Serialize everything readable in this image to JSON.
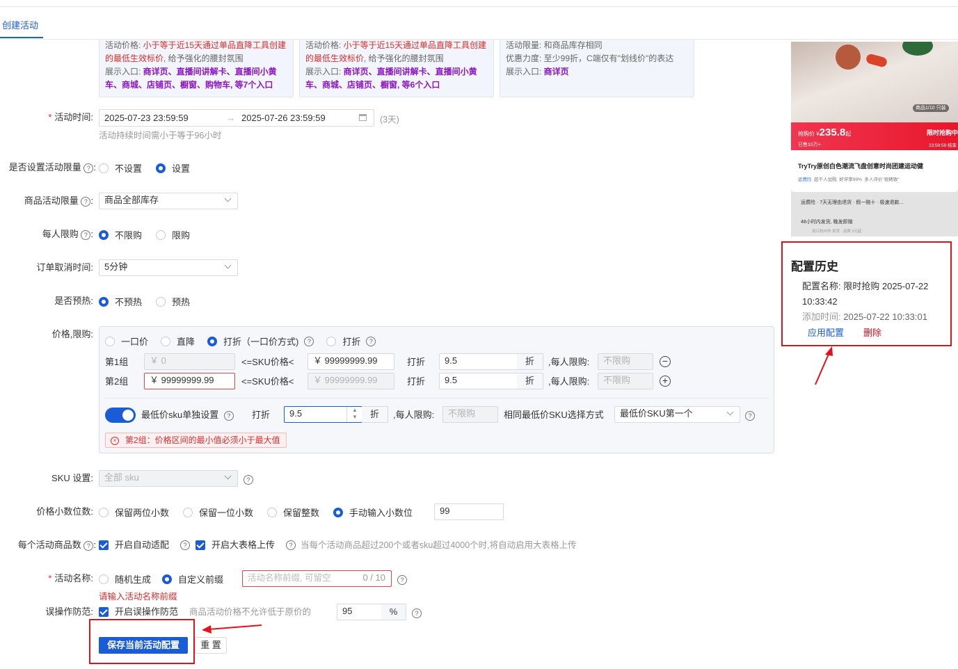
{
  "tab": {
    "label": "创建活动"
  },
  "cards": [
    {
      "line1_label": "活动价格: ",
      "line1_red": "小于等于近15天通过单品直降工具创建",
      "line2_red": "的最低生效标价",
      "line2_rest": ", 给予强化的腰封氛围",
      "line3_label": "展示入口: ",
      "line3_purple": "商详页、直播间讲解卡、直播间小黄",
      "line4_purple": "车、商城、店铺页、橱窗、购物车, 等7个入口"
    },
    {
      "line1_label": "活动价格: ",
      "line1_red": "小于等于近15天通过单品直降工具创建",
      "line2_red": "的最低生效标价",
      "line2_rest": ", 给予强化的腰封氛围",
      "line3_label": "展示入口: ",
      "line3_purple": "商详页、直播间讲解卡、直播间小黄",
      "line4_purple": "车、商城、店铺页、橱窗, 等6个入口"
    },
    {
      "line1": "活动限量: 和商品库存相同",
      "line2": "优惠力度: 至少99折，C端仅有\"划线价\"的表达",
      "line3_label": "展示入口: ",
      "line3_purple": "商详页"
    }
  ],
  "time": {
    "label": "活动时间:",
    "start": "2025-07-23 23:59:59",
    "end": "2025-07-26 23:59:59",
    "days": "(3天)",
    "hint": "活动持续时间需小于等于96小时"
  },
  "limit_setting": {
    "label": "是否设置活动限量",
    "options": [
      "不设置",
      "设置"
    ],
    "selected": 1
  },
  "product_limit": {
    "label": "商品活动限量",
    "value": "商品全部库存"
  },
  "per_person": {
    "label": "每人限购",
    "options": [
      "不限购",
      "限购"
    ],
    "selected": 0
  },
  "cancel_time": {
    "label": "订单取消时间:",
    "value": "5分钟"
  },
  "preheat": {
    "label": "是否预热:",
    "options": [
      "不预热",
      "预热"
    ],
    "selected": 0
  },
  "price": {
    "label": "价格,限购:",
    "modes": [
      "一口价",
      "直降",
      "打折（一口价方式)",
      "打折"
    ],
    "selected": 2,
    "groups": [
      {
        "name": "第1组",
        "min": "￥ 0",
        "mid": "<=SKU价格<",
        "max": "￥ 99999999.99",
        "discount_label": "打折",
        "discount": "9.5",
        "unit": "折",
        "limit_label": ",每人限购:",
        "limit_placeholder": "不限购",
        "action": "−"
      },
      {
        "name": "第2组",
        "min": "￥ 99999999.99",
        "mid": "<=SKU价格<",
        "max": "￥ 99999999.99",
        "discount_label": "打折",
        "discount": "9.5",
        "unit": "折",
        "limit_label": ",每人限购:",
        "limit_placeholder": "不限购",
        "action": "+"
      }
    ],
    "lowest": {
      "label": "最低价sku单独设置",
      "discount_label": "打折",
      "discount": "9.5",
      "unit": "折",
      "limit_label": ",每人限购:",
      "limit_placeholder": "不限购",
      "select_label": "相同最低价SKU选择方式",
      "select_value": "最低价SKU第一个"
    },
    "error": "第2组：价格区间的最小值必须小于最大值"
  },
  "sku": {
    "label": "SKU 设置:",
    "placeholder": "全部 sku"
  },
  "decimals": {
    "label": "价格小数位数:",
    "options": [
      "保留两位小数",
      "保留一位小数",
      "保留整数",
      "手动输入小数位"
    ],
    "selected": 3,
    "value": "99"
  },
  "per_activity": {
    "label": "每个活动商品数",
    "auto": "开启自动适配",
    "big": "开启大表格上传",
    "hint": "当每个活动商品超过200个或者sku超过4000个时,将自动启用大表格上传"
  },
  "name": {
    "label": "活动名称:",
    "options": [
      "随机生成",
      "自定义前缀"
    ],
    "selected": 1,
    "placeholder": "活动名称前缀, 可留空",
    "count": "0 / 10",
    "error": "请输入活动名称前缀"
  },
  "misop": {
    "label": "误操作防范:",
    "check": "开启误操作防范",
    "hint": "商品活动价格不允许低于原价的",
    "value": "95",
    "unit": "%"
  },
  "buttons": {
    "save": "保存当前活动配置",
    "reset": "重 置"
  },
  "preview": {
    "price_prefix": "抢购价 ¥",
    "price": "235.8",
    "price_suffix": "起",
    "sold": "已售10万+",
    "badge": "限时抢购中",
    "timer": "23:59:59 结束",
    "counter": "商品1/10",
    "counter2": "只装",
    "title": "TryTry原创白色潮流飞盘创意时尚团建运动健",
    "tags": [
      "运费险",
      "超千人加购",
      "好评率99%",
      "多人评价\"很精致\""
    ],
    "service": "运费险 · 7天无理由退货 · 假一赔十 · 极速退款...",
    "ship": "48小时内发货, 晚发即赔",
    "ship_sub": "浙江杭州市 发货 · 运费 5元起"
  },
  "history": {
    "title": "配置历史",
    "name_label": "配置名称:",
    "name_value": "限时抢购 2025-07-22 10:33:42",
    "time_label": "添加时间:",
    "time_value": "2025-07-22 10:33:01",
    "apply": "应用配置",
    "delete": "删除"
  },
  "colors": {
    "primary": "#1a5bd6",
    "danger": "#e4101a"
  }
}
